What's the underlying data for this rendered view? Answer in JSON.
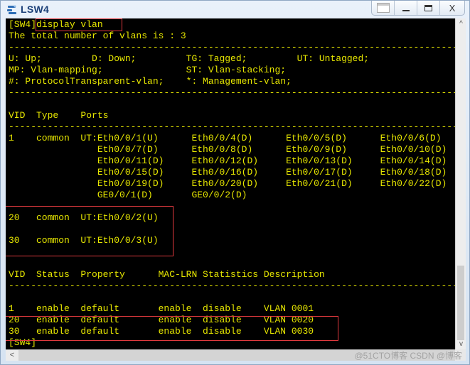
{
  "window": {
    "title": "LSW4",
    "controls": {
      "layout": "layout",
      "minimize": "minimize",
      "maximize": "maximize",
      "close": "X"
    }
  },
  "terminal": {
    "prompt": "[SW4]",
    "command": "display vlan",
    "summary": "The total number of vlans is : 3",
    "separator": "------------------------------------------------------------------------------------------",
    "legend": [
      "U: Up;         D: Down;         TG: Tagged;         UT: Untagged;",
      "MP: Vlan-mapping;               ST: Vlan-stacking;",
      "#: ProtocolTransparent-vlan;    *: Management-vlan;"
    ],
    "ports_header": "VID  Type    Ports",
    "ports_rows": [
      "1    common  UT:Eth0/0/1(U)      Eth0/0/4(D)      Eth0/0/5(D)      Eth0/0/6(D)",
      "                Eth0/0/7(D)      Eth0/0/8(D)      Eth0/0/9(D)      Eth0/0/10(D)",
      "                Eth0/0/11(D)     Eth0/0/12(D)     Eth0/0/13(D)     Eth0/0/14(D)",
      "                Eth0/0/15(D)     Eth0/0/16(D)     Eth0/0/17(D)     Eth0/0/18(D)",
      "                Eth0/0/19(D)     Eth0/0/20(D)     Eth0/0/21(D)     Eth0/0/22(D)",
      "                GE0/0/1(D)       GE0/0/2(D)"
    ],
    "vlan20_row": "20   common  UT:Eth0/0/2(U)",
    "vlan30_row": "30   common  UT:Eth0/0/3(U)",
    "status_header": "VID  Status  Property      MAC-LRN Statistics Description",
    "status_rows": [
      "1    enable  default       enable  disable    VLAN 0001",
      "20   enable  default       enable  disable    VLAN 0020",
      "30   enable  default       enable  disable    VLAN 0030"
    ],
    "final_prompt": "[SW4]"
  },
  "scrollbars": {
    "up": "^",
    "down": "v",
    "left": "<"
  },
  "watermark": "@51CTO博客  CSDN @博客",
  "colors": {
    "text": "#e6e600",
    "background": "#000000",
    "highlight": "#e0393e"
  }
}
